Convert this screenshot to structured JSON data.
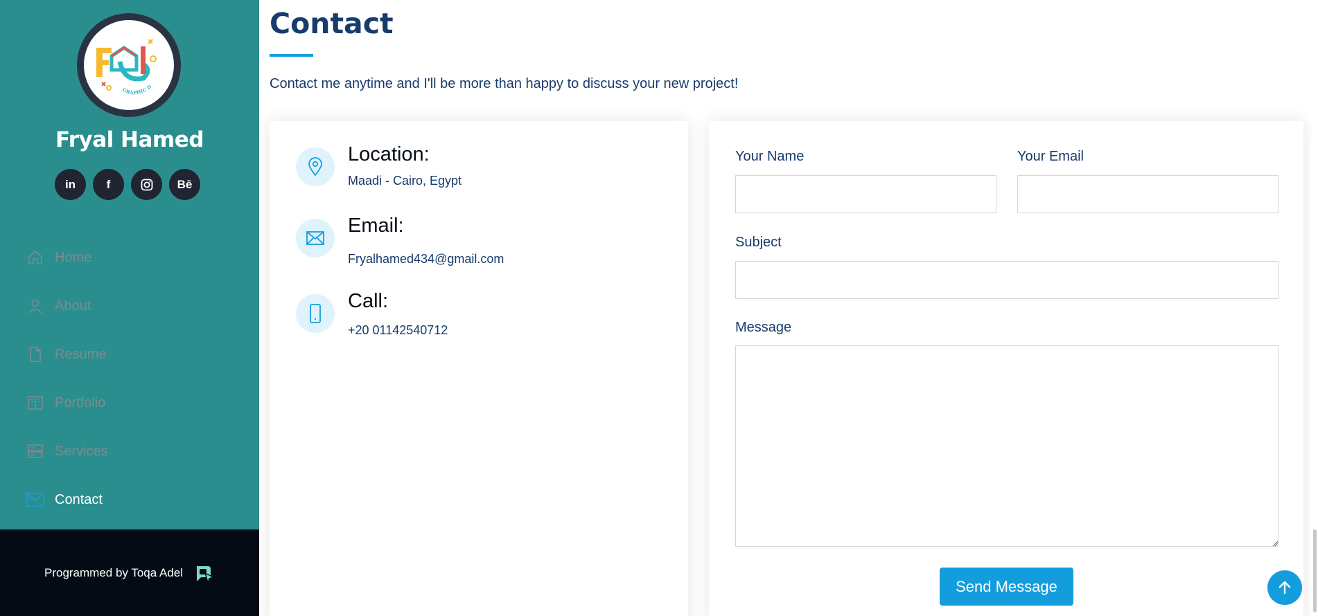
{
  "colors": {
    "sidebar_bg": "#2a8e8e",
    "sidebar_footer_bg": "#040b14",
    "accent": "#149ddd",
    "heading": "#173b6c",
    "nav_inactive": "#7c8b8f"
  },
  "profile": {
    "name": "Fryal Hamed",
    "logo_text": "GRAPHIC DESIGN"
  },
  "socials": [
    {
      "icon": "linkedin-icon",
      "label": "in"
    },
    {
      "icon": "facebook-icon",
      "label": "f"
    },
    {
      "icon": "instagram-icon",
      "label": ""
    },
    {
      "icon": "behance-icon",
      "label": "Bē"
    }
  ],
  "nav": [
    {
      "label": "Home",
      "icon": "home-icon",
      "active": false
    },
    {
      "label": "About",
      "icon": "person-icon",
      "active": false
    },
    {
      "label": "Resume",
      "icon": "file-icon",
      "active": false
    },
    {
      "label": "Portfolio",
      "icon": "book-icon",
      "active": false
    },
    {
      "label": "Services",
      "icon": "server-icon",
      "active": false
    },
    {
      "label": "Contact",
      "icon": "envelope-icon",
      "active": true
    }
  ],
  "footer": {
    "text": "Programmed by Toqa Adel",
    "logo_icon": "developer-logo-icon"
  },
  "contact": {
    "title": "Contact",
    "description": "Contact me anytime and I'll be more than happy to discuss your new project!",
    "info": [
      {
        "heading": "Location:",
        "value": "Maadi - Cairo, Egypt",
        "icon": "map-pin-icon"
      },
      {
        "heading": "Email:",
        "value": "Fryalhamed434@gmail.com",
        "icon": "envelope-icon"
      },
      {
        "heading": "Call:",
        "value": "+20 01142540712",
        "icon": "phone-icon"
      }
    ],
    "form": {
      "name_label": "Your Name",
      "name_value": "",
      "email_label": "Your Email",
      "email_value": "",
      "subject_label": "Subject",
      "subject_value": "",
      "message_label": "Message",
      "message_value": "",
      "submit_label": "Send Message"
    }
  },
  "back_to_top_icon": "arrow-up-icon"
}
